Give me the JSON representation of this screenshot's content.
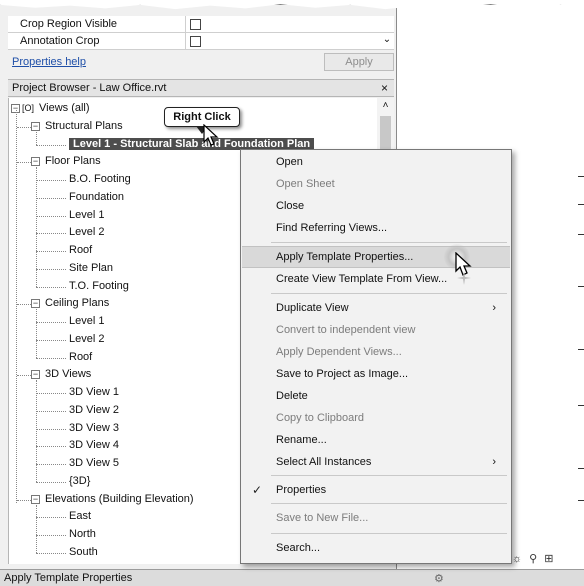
{
  "properties": {
    "rows": [
      {
        "name": "Crop Region Visible"
      },
      {
        "name": "Annotation Crop"
      }
    ],
    "help_link": "Properties help",
    "apply_button": "Apply"
  },
  "project_browser": {
    "title": "Project Browser - Law Office.rvt",
    "close_glyph": "×",
    "tree": [
      {
        "label": "Views (all)",
        "level": 0
      },
      {
        "label": "Structural Plans",
        "level": 1
      },
      {
        "label": "Level 1 - Structural Slab and Foundation Plan",
        "level": 2,
        "selected": true
      },
      {
        "label": "Floor Plans",
        "level": 1
      },
      {
        "label": "B.O. Footing",
        "level": 2
      },
      {
        "label": "Foundation",
        "level": 2
      },
      {
        "label": "Level 1",
        "level": 2
      },
      {
        "label": "Level 2",
        "level": 2
      },
      {
        "label": "Roof",
        "level": 2
      },
      {
        "label": "Site Plan",
        "level": 2
      },
      {
        "label": "T.O. Footing",
        "level": 2
      },
      {
        "label": "Ceiling Plans",
        "level": 1
      },
      {
        "label": "Level 1",
        "level": 2
      },
      {
        "label": "Level 2",
        "level": 2
      },
      {
        "label": "Roof",
        "level": 2
      },
      {
        "label": "3D Views",
        "level": 1
      },
      {
        "label": "3D View 1",
        "level": 2
      },
      {
        "label": "3D View 2",
        "level": 2
      },
      {
        "label": "3D View 3",
        "level": 2
      },
      {
        "label": "3D View 4",
        "level": 2
      },
      {
        "label": "3D View 5",
        "level": 2
      },
      {
        "label": "{3D}",
        "level": 2
      },
      {
        "label": "Elevations (Building Elevation)",
        "level": 1
      },
      {
        "label": "East",
        "level": 2
      },
      {
        "label": "North",
        "level": 2
      },
      {
        "label": "South",
        "level": 2
      }
    ]
  },
  "callout": {
    "label": "Right Click"
  },
  "context_menu": {
    "items": [
      {
        "label": "Open"
      },
      {
        "label": "Open Sheet",
        "disabled": true
      },
      {
        "label": "Close"
      },
      {
        "label": "Find Referring Views..."
      },
      {
        "label": "Apply Template Properties...",
        "highlighted": true
      },
      {
        "label": "Create View Template From View..."
      },
      {
        "label": "Duplicate View",
        "submenu": true
      },
      {
        "label": "Convert to independent view",
        "disabled": true
      },
      {
        "label": "Apply Dependent Views...",
        "disabled": true
      },
      {
        "label": "Save to Project as Image..."
      },
      {
        "label": "Delete"
      },
      {
        "label": "Copy to Clipboard",
        "disabled": true
      },
      {
        "label": "Rename..."
      },
      {
        "label": "Select All Instances",
        "submenu": true
      },
      {
        "label": "Properties",
        "checked": true
      },
      {
        "label": "Save to New File...",
        "disabled": true
      },
      {
        "label": "Search..."
      }
    ],
    "submenu_arrow": "›",
    "check_glyph": "✓"
  },
  "status_bar": {
    "text": "Apply Template Properties"
  },
  "colors": {
    "selection": "#4d4d4d",
    "menu_bg": "#f2f2f2",
    "link": "#1f4fa8"
  }
}
